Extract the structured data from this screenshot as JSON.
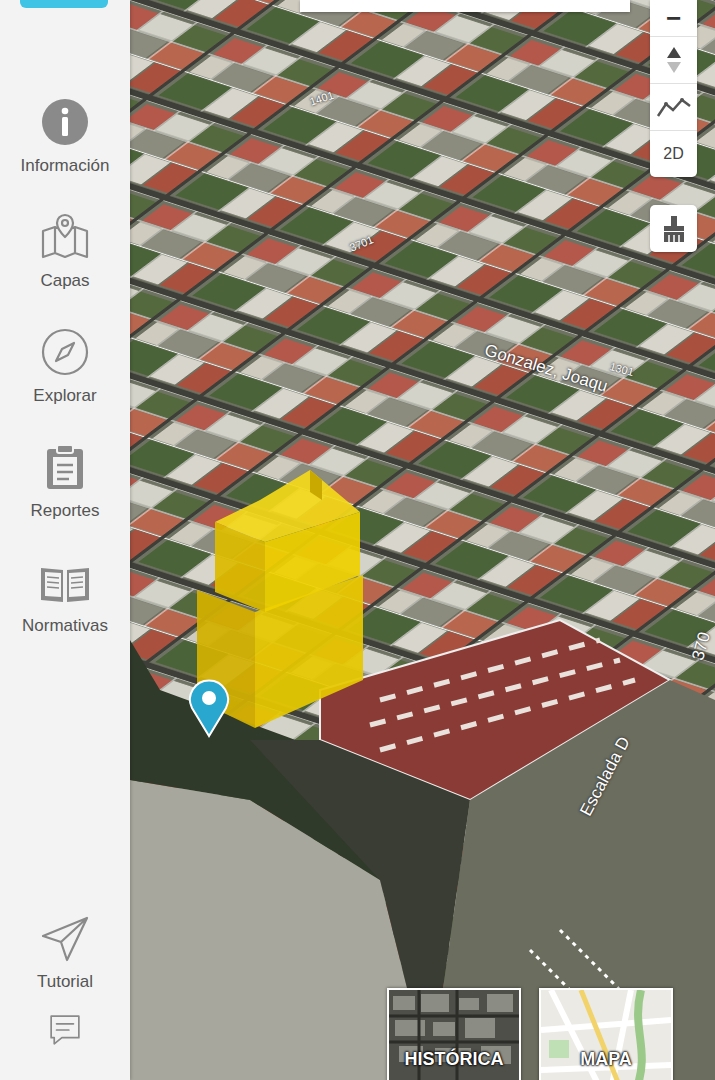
{
  "sidebar": {
    "items": [
      {
        "label": "Información"
      },
      {
        "label": "Capas"
      },
      {
        "label": "Explorar"
      },
      {
        "label": "Reportes"
      },
      {
        "label": "Normativas"
      }
    ],
    "footer_items": [
      {
        "label": "Tutorial"
      }
    ]
  },
  "map_controls": {
    "zoom_out": "−",
    "view_mode": "2D"
  },
  "map_labels": [
    "1401",
    "3701",
    "Gonzalez, Joaqu",
    "1301",
    "Escalada D",
    "370"
  ],
  "base_layers": [
    {
      "label": "HISTÓRICA",
      "selected": false
    },
    {
      "label": "MAPA",
      "selected": false
    }
  ]
}
